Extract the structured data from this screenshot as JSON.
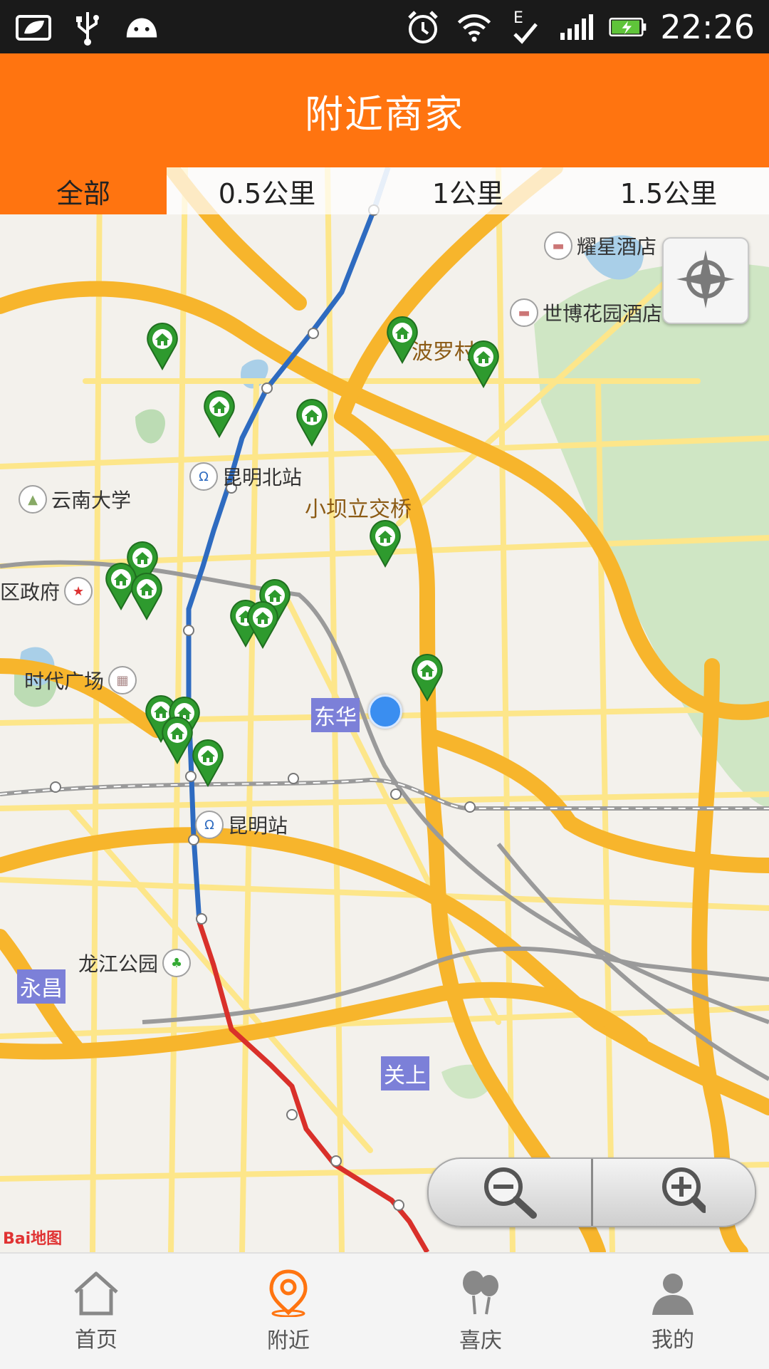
{
  "status_bar": {
    "time": "22:26",
    "network_type": "E",
    "icons_left": [
      "leaf-notification-icon",
      "usb-icon",
      "android-icon"
    ],
    "icons_right": [
      "alarm-icon",
      "wifi-icon",
      "edge-network-icon",
      "signal-icon",
      "battery-charging-icon"
    ]
  },
  "header": {
    "title": "附近商家"
  },
  "filter_tabs": [
    {
      "label": "全部",
      "active": true
    },
    {
      "label": "0.5公里",
      "active": false
    },
    {
      "label": "1公里",
      "active": false
    },
    {
      "label": "1.5公里",
      "active": false
    }
  ],
  "map": {
    "provider_logo": "Bai地图",
    "labels": {
      "poluo_village": "波罗村",
      "xiaobali_bridge": "小坝立交桥",
      "donghua": "东华",
      "guanshang": "关上",
      "yongchang": "永昌",
      "district_gov": "区政府"
    },
    "pois": {
      "yaoxing_hotel": "耀星酒店",
      "shibo_hotel": "世博花园酒店",
      "kunming_north_station": "昆明北站",
      "yunnan_university": "云南大学",
      "times_square": "时代广场",
      "kunming_station": "昆明站",
      "longjiang_park": "龙江公园"
    },
    "marker_icon": "shop-marker-icon",
    "marker_color": "#2e9a2e",
    "user_location_color": "#3a8ef0"
  },
  "controls": {
    "locate_icon": "locate-compass-icon",
    "zoom_out_icon": "zoom-out-icon",
    "zoom_in_icon": "zoom-in-icon"
  },
  "bottom_nav": [
    {
      "label": "首页",
      "icon": "home-icon",
      "active": false
    },
    {
      "label": "附近",
      "icon": "location-pin-icon",
      "active": true
    },
    {
      "label": "喜庆",
      "icon": "balloons-icon",
      "active": false
    },
    {
      "label": "我的",
      "icon": "user-icon",
      "active": false
    }
  ],
  "colors": {
    "accent": "#ff7410",
    "road_main": "#f7b52c",
    "road_minor": "#fde68a",
    "metro_blue": "#2e6bc0",
    "metro_red": "#d9302a",
    "park_green": "#bfe0b4"
  }
}
